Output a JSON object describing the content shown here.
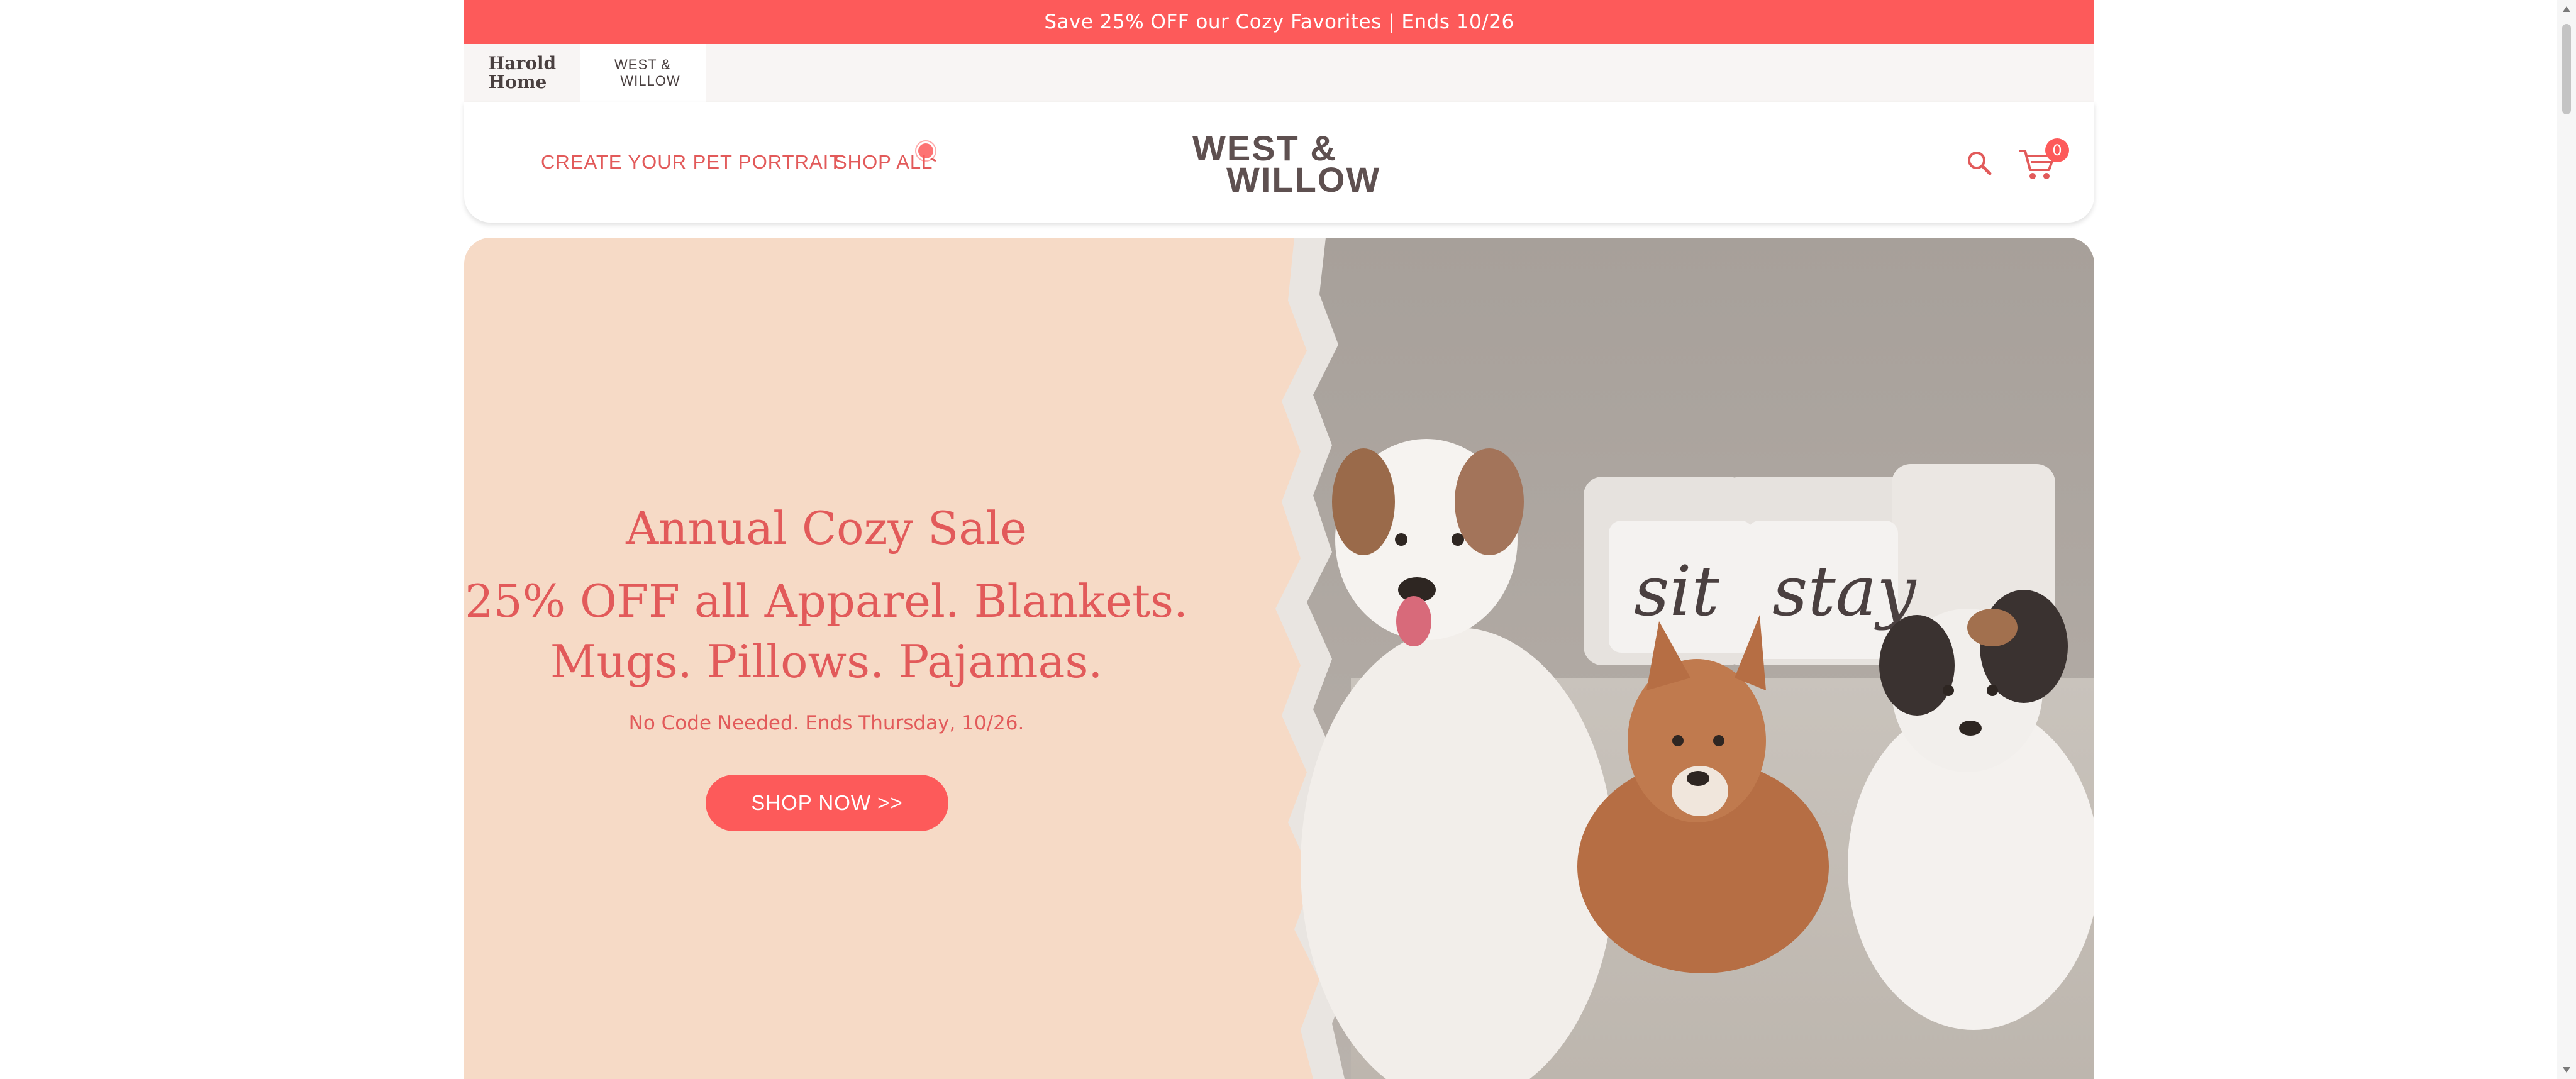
{
  "announcement": {
    "text": "Save 25% OFF our Cozy Favorites | Ends 10/26"
  },
  "brand_tabs": [
    {
      "line1": "Harold",
      "line2": "Home"
    },
    {
      "line1": "WEST &",
      "line2": "WILLOW"
    }
  ],
  "nav": {
    "links": [
      "CREATE YOUR PET PORTRAIT",
      "SHOP ALL"
    ],
    "logo_line1": "WEST &",
    "logo_line2": "WILLOW",
    "cart_count": "0"
  },
  "hero": {
    "title": "Annual Cozy Sale",
    "sub_line1": "25% OFF all Apparel. Blankets.",
    "sub_line2": "Mugs. Pillows. Pajamas.",
    "note": "No Code Needed. Ends Thursday, 10/26.",
    "button": "SHOP NOW >>",
    "pillow_left": "sit",
    "pillow_right": "stay"
  },
  "colors": {
    "accent": "#fd5a5a",
    "hero_bg": "#f6dac6",
    "logo": "#5e5050"
  },
  "icons": [
    "search-icon",
    "cart-icon",
    "cursor-indicator-icon",
    "scroll-up-icon",
    "scroll-down-icon"
  ]
}
